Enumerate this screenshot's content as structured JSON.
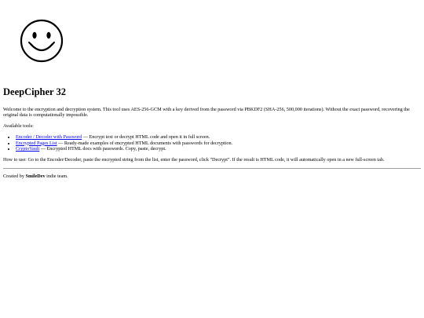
{
  "logo": {
    "icon": "smiley-face-icon",
    "color": "#000000"
  },
  "title": "DeepCipher 32",
  "intro": "Welcome to the encryption and decryption system. This tool uses AES-256-GCM with a key derived from the password via PBKDF2 (SHA-256, 500,000 iterations). Without the exact password, recovering the original data is computationally impossible.",
  "tools_heading": "Available tools:",
  "tools": [
    {
      "link": "Encoder / Decoder with Password",
      "desc": " — Encrypt text or decrypt HTML code and open it in full screen."
    },
    {
      "link": "Encrypted Pages List",
      "desc": " — Ready-made examples of encrypted HTML documents with passwords for decryption."
    },
    {
      "link": "CryptoVault",
      "desc": " — Encrypted HTML docs with passwords. Copy, paste, decrypt."
    }
  ],
  "howto": "How to use: Go to the Encoder/Decoder, paste the encrypted string from the list, enter the password, click \"Decrypt\". If the result is HTML code, it will automatically open in a new full-screen tab.",
  "footer": {
    "prefix": "Created by ",
    "team": "SmileDev",
    "suffix": " indie team."
  },
  "colors": {
    "link": "#0000ee",
    "text": "#000000",
    "rule": "#a0a0a0"
  }
}
